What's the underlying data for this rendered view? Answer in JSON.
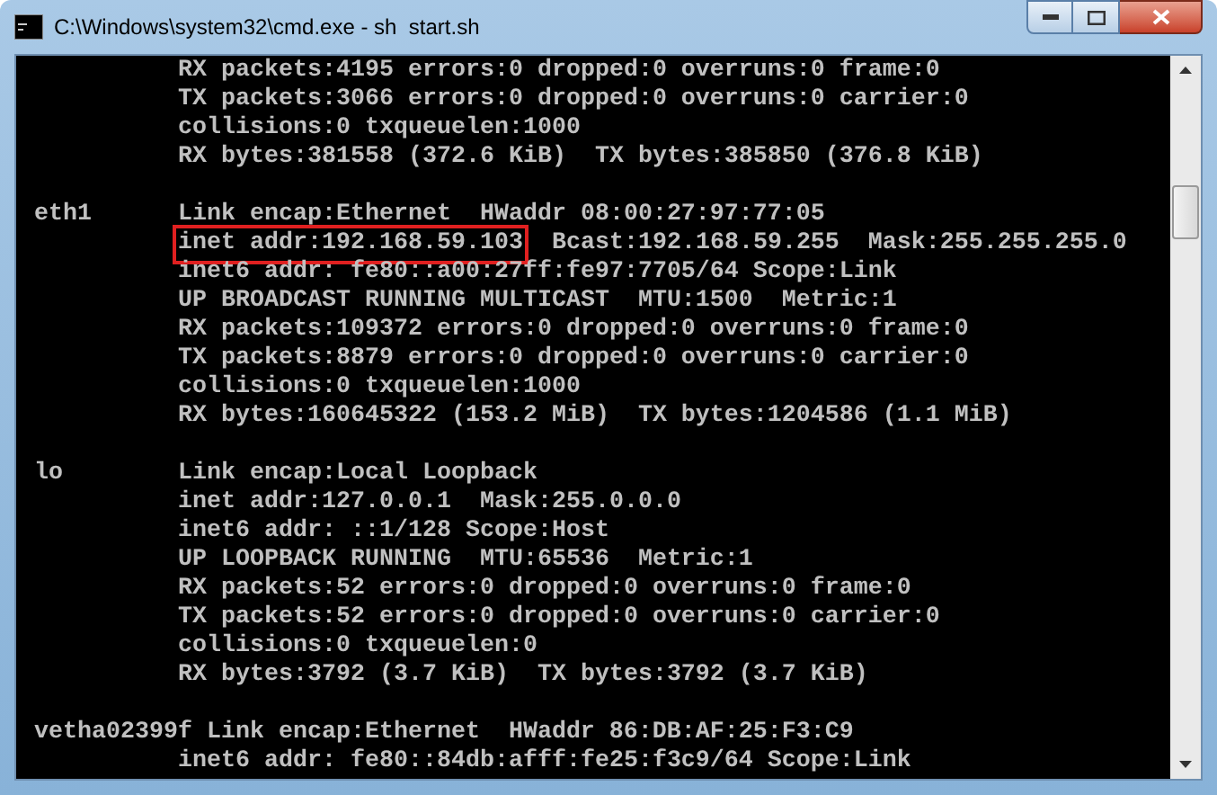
{
  "window": {
    "title": "C:\\Windows\\system32\\cmd.exe - sh  start.sh"
  },
  "console": {
    "interfaces": [
      {
        "lines": [
          {
            "text": "RX packets:4195 errors:0 dropped:0 overruns:0 frame:0",
            "boxed": false
          },
          {
            "text": "TX packets:3066 errors:0 dropped:0 overruns:0 carrier:0",
            "boxed": false
          },
          {
            "text": "collisions:0 txqueuelen:1000",
            "boxed": false
          },
          {
            "text": "RX bytes:381558 (372.6 KiB)  TX bytes:385850 (376.8 KiB)",
            "boxed": false
          }
        ]
      },
      {
        "name": "eth1",
        "lines": [
          {
            "text": "Link encap:Ethernet  HWaddr 08:00:27:97:77:05",
            "boxed": false
          },
          {
            "text": "inet addr:192.168.59.103",
            "boxed": true,
            "rest": "Bcast:192.168.59.255  Mask:255.255.255.0"
          },
          {
            "text": "inet6 addr: fe80::a00:27ff:fe97:7705/64 Scope:Link",
            "boxed": false
          },
          {
            "text": "UP BROADCAST RUNNING MULTICAST  MTU:1500  Metric:1",
            "boxed": false
          },
          {
            "text": "RX packets:109372 errors:0 dropped:0 overruns:0 frame:0",
            "boxed": false
          },
          {
            "text": "TX packets:8879 errors:0 dropped:0 overruns:0 carrier:0",
            "boxed": false
          },
          {
            "text": "collisions:0 txqueuelen:1000",
            "boxed": false
          },
          {
            "text": "RX bytes:160645322 (153.2 MiB)  TX bytes:1204586 (1.1 MiB)",
            "boxed": false
          }
        ]
      },
      {
        "name": "lo",
        "lines": [
          {
            "text": "Link encap:Local Loopback",
            "boxed": false
          },
          {
            "text": "inet addr:127.0.0.1  Mask:255.0.0.0",
            "boxed": false
          },
          {
            "text": "inet6 addr: ::1/128 Scope:Host",
            "boxed": false
          },
          {
            "text": "UP LOOPBACK RUNNING  MTU:65536  Metric:1",
            "boxed": false
          },
          {
            "text": "RX packets:52 errors:0 dropped:0 overruns:0 frame:0",
            "boxed": false
          },
          {
            "text": "TX packets:52 errors:0 dropped:0 overruns:0 carrier:0",
            "boxed": false
          },
          {
            "text": "collisions:0 txqueuelen:0",
            "boxed": false
          },
          {
            "text": "RX bytes:3792 (3.7 KiB)  TX bytes:3792 (3.7 KiB)",
            "boxed": false
          }
        ]
      },
      {
        "name": "vetha02399f",
        "lines": [
          {
            "text": "Link encap:Ethernet  HWaddr 86:DB:AF:25:F3:C9",
            "boxed": false
          },
          {
            "text": "inet6 addr: fe80::84db:afff:fe25:f3c9/64 Scope:Link",
            "boxed": false
          }
        ]
      }
    ]
  }
}
